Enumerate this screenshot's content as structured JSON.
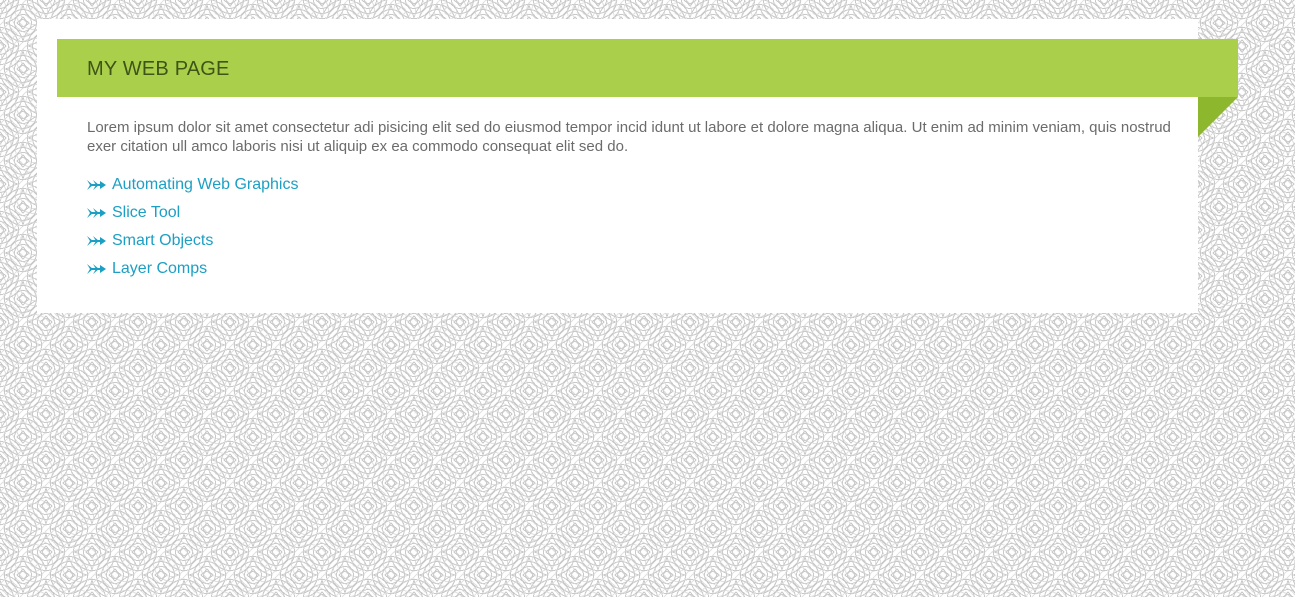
{
  "page": {
    "title": "MY WEB PAGE",
    "intro": "Lorem ipsum dolor sit amet consectetur adi pisicing elit sed do eiusmod tempor incid idunt ut labore et dolore magna aliqua. Ut enim ad minim veniam, quis nostrud exer citation ull amco laboris nisi ut aliquip ex ea commodo consequat elit sed do."
  },
  "links": [
    {
      "label": "Automating Web Graphics",
      "icon": "double-arrow-right-icon"
    },
    {
      "label": "Slice Tool",
      "icon": "double-arrow-right-icon"
    },
    {
      "label": "Smart Objects",
      "icon": "double-arrow-right-icon"
    },
    {
      "label": "Layer Comps",
      "icon": "double-arrow-right-icon"
    }
  ],
  "colors": {
    "banner": "#aad04b",
    "banner_fold": "#8db82e",
    "title_text": "#3f5417",
    "body_text": "#6b6b6b",
    "link": "#1c9fc4",
    "background_pattern": "#c9c9c9"
  }
}
